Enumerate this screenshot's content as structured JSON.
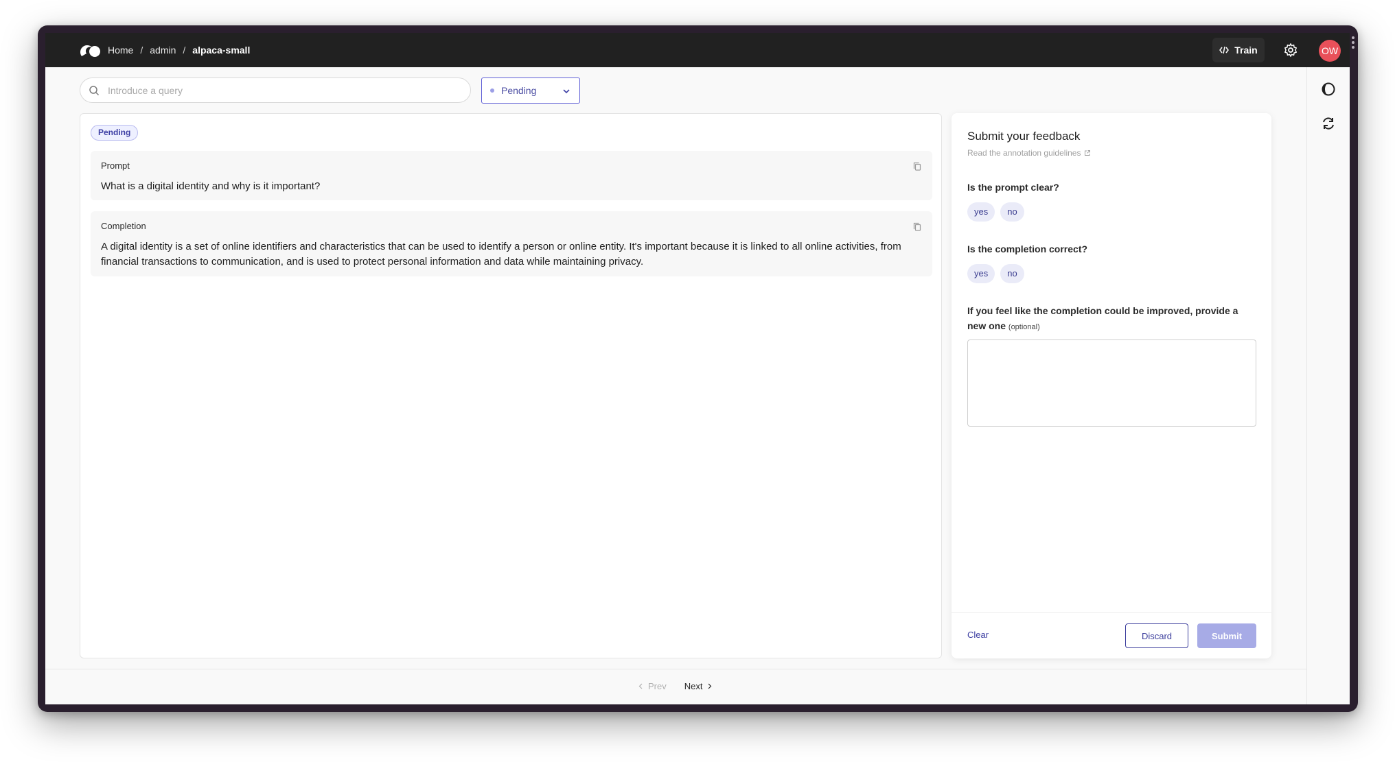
{
  "header": {
    "breadcrumb": [
      {
        "label": "Home"
      },
      {
        "label": "admin"
      },
      {
        "label": "alpaca-small"
      }
    ],
    "separator": "/",
    "train_label": "Train",
    "avatar_initials": "OW"
  },
  "toolbar": {
    "search_placeholder": "Introduce a query",
    "status_filter": "Pending"
  },
  "record": {
    "status_badge": "Pending",
    "fields": [
      {
        "title": "Prompt",
        "text": "What is a digital identity and why is it important?"
      },
      {
        "title": "Completion",
        "text": "A digital identity is a set of online identifiers and characteristics that can be used to identify a person or online entity. It's important because it is linked to all online activities, from financial transactions to communication, and is used to protect personal information and data while maintaining privacy."
      }
    ]
  },
  "feedback": {
    "title": "Submit your feedback",
    "guidelines_link": "Read the annotation guidelines",
    "questions": [
      {
        "label": "Is the prompt clear?",
        "options": [
          "yes",
          "no"
        ]
      },
      {
        "label": "Is the completion correct?",
        "options": [
          "yes",
          "no"
        ]
      }
    ],
    "text_question": {
      "label": "If you feel like the completion could be improved, provide a new one",
      "optional": "(optional)",
      "value": ""
    },
    "clear_label": "Clear",
    "discard_label": "Discard",
    "submit_label": "Submit"
  },
  "pagination": {
    "prev_label": "Prev",
    "next_label": "Next"
  },
  "colors": {
    "accent": "#3e40a5",
    "topbar": "#212121",
    "avatar": "#e9505a",
    "submit_disabled": "#a7abe6"
  },
  "icons": {
    "logo": "argilla-logo-icon",
    "train": "code-icon",
    "settings": "gear-icon",
    "theme": "contrast-icon",
    "refresh": "refresh-icon",
    "search": "search-icon",
    "copy": "copy-icon",
    "external": "external-link-icon"
  }
}
